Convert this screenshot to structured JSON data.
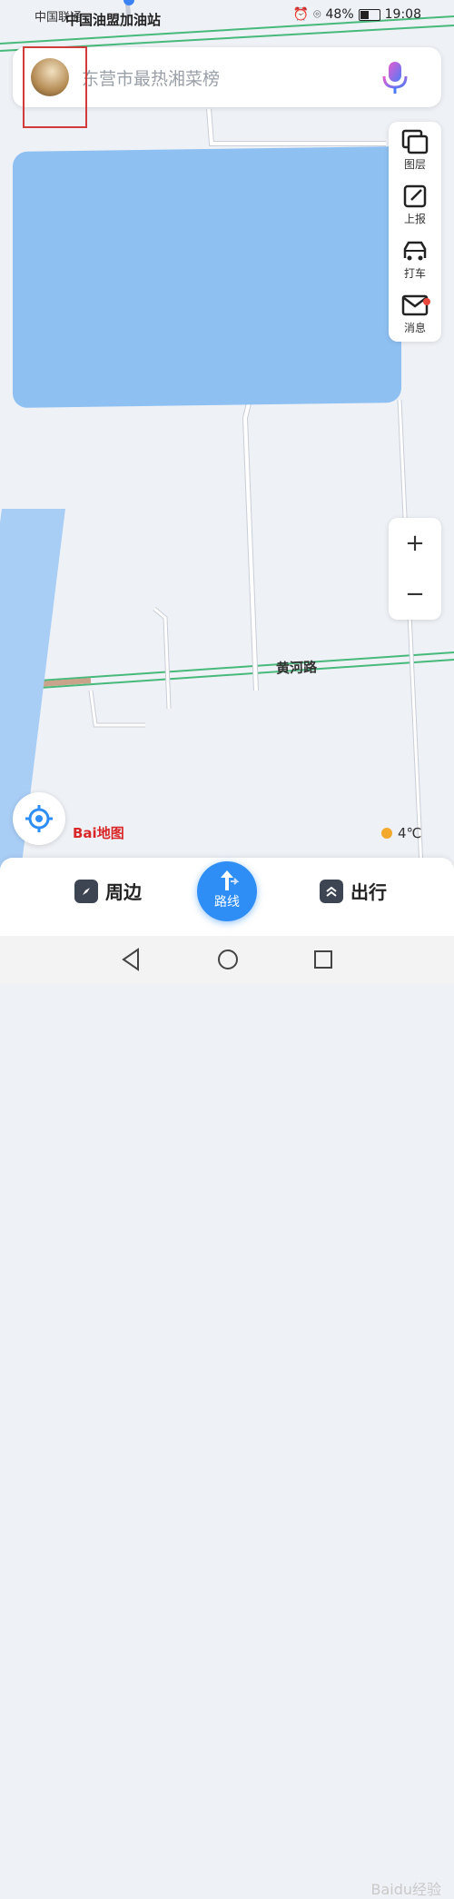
{
  "status_bar": {
    "carrier": "中国联通",
    "battery": "48%",
    "time": "19:08"
  },
  "map": {
    "poi_title": "中国油盟加油站",
    "road_label": "黄河路",
    "logo_text": "Bai地图",
    "weather": "4℃"
  },
  "search": {
    "placeholder": "东营市最热湘菜榜"
  },
  "toolbar": {
    "layers": "图层",
    "report": "上报",
    "taxi": "打车",
    "messages": "消息"
  },
  "zoom": {
    "in": "+",
    "out": "−"
  },
  "bottom_bar": {
    "nearby": "周边",
    "route": "路线",
    "travel": "出行"
  },
  "watermark": "Baidu经验",
  "colors": {
    "accent": "#2f8ef5",
    "lake": "#8fc0f2",
    "road_green": "#47b97a",
    "highlight": "#d23b3b"
  }
}
